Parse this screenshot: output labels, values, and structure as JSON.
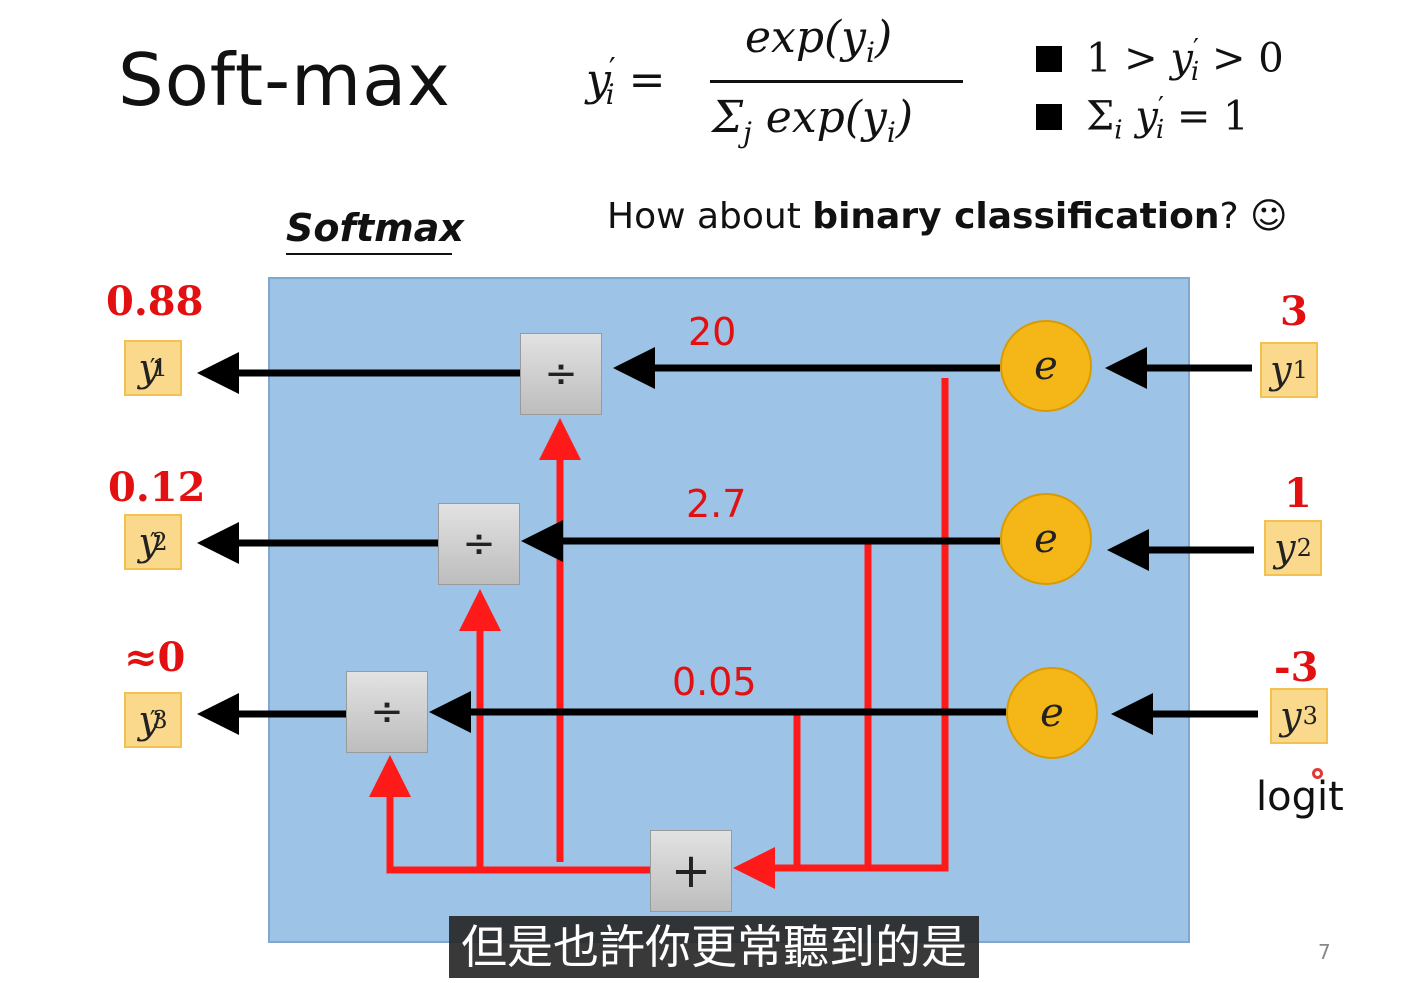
{
  "slide": {
    "title": "Soft-max",
    "formula": {
      "lhs_base": "y",
      "lhs_sub": "i",
      "lhs_prime": "′",
      "equals": "=",
      "numerator": "exp(y",
      "numerator_sub": "i",
      "numerator_close": ")",
      "denominator_sigma": "Σ",
      "denominator_sigma_sub": "j",
      "denominator": "exp(y",
      "denominator_sub": "i",
      "denominator_close": ")"
    },
    "properties": [
      {
        "text_a": "1 > ",
        "var": "y",
        "sub": "i",
        "prime": "′",
        "text_b": " > 0"
      },
      {
        "text_a": "Σ",
        "sigma_sub": "i",
        "var": "y",
        "sub": "i",
        "prime": "′",
        "text_b": " = 1"
      }
    ],
    "subtitle": "Softmax",
    "question_plain": "How about ",
    "question_bold": "binary classification",
    "question_end": "? ☺",
    "outputs": [
      {
        "value": "0.88",
        "var": "y",
        "sub": "1",
        "prime": "′"
      },
      {
        "value": "0.12",
        "var": "y",
        "sub": "2",
        "prime": "′"
      },
      {
        "value": "≈0",
        "var": "y",
        "sub": "3",
        "prime": "′"
      }
    ],
    "inputs": [
      {
        "value": "3",
        "var": "y",
        "sub": "1"
      },
      {
        "value": "1",
        "var": "y",
        "sub": "2"
      },
      {
        "value": "-3",
        "var": "y",
        "sub": "3"
      }
    ],
    "exp_values": [
      "20",
      "2.7",
      "0.05"
    ],
    "exp_label": "e",
    "divide_symbol": "÷",
    "sum_symbol": "+",
    "logit_label": "logit",
    "page_number": "7"
  },
  "subtitle_caption": "但是也許你更常聽到的是",
  "colors": {
    "panel": "#9dc3e6",
    "wire_red": "#ff1a1a",
    "arrow_black": "#000000",
    "node_orange": "#f5b718",
    "ybox_fill": "#fbd98c",
    "value_red": "#e21010"
  }
}
